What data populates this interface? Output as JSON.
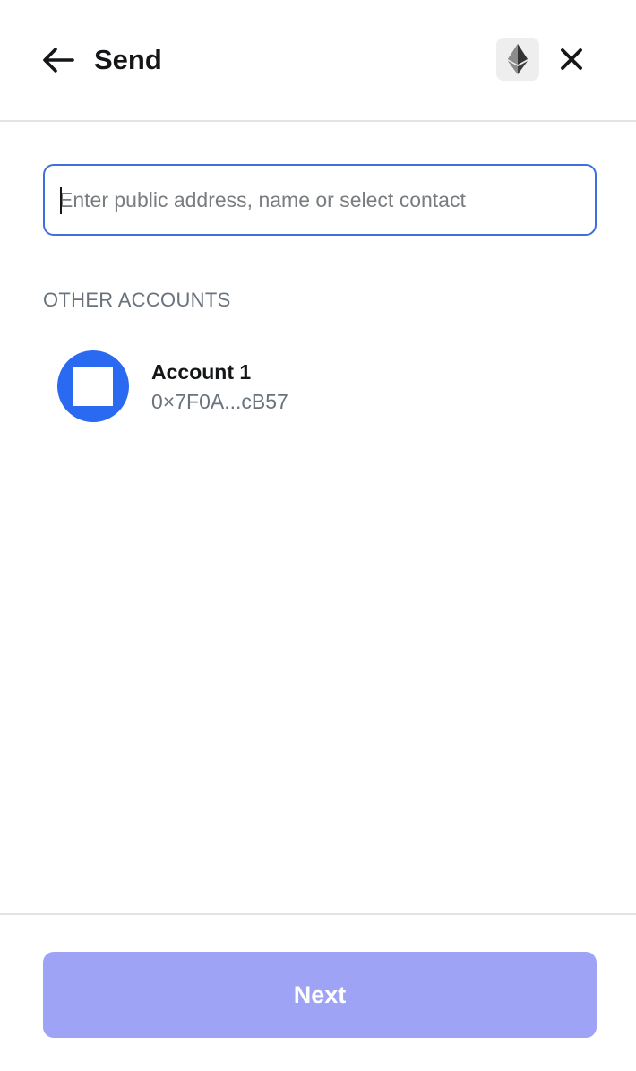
{
  "header": {
    "title": "Send",
    "back_icon": "arrow-left-icon",
    "network_icon": "ethereum-icon",
    "close_icon": "close-icon"
  },
  "search": {
    "value": "",
    "placeholder": "Enter public address, name or select contact"
  },
  "accounts_section": {
    "label": "OTHER ACCOUNTS",
    "items": [
      {
        "name": "Account 1",
        "address": "0×7F0A...cB57",
        "avatar_color": "#2a6af0"
      }
    ]
  },
  "footer": {
    "next_label": "Next",
    "next_color": "#9fa3f5"
  },
  "colors": {
    "accent": "#3f6fdc",
    "text_primary": "#141618",
    "text_muted": "#6a737d"
  }
}
